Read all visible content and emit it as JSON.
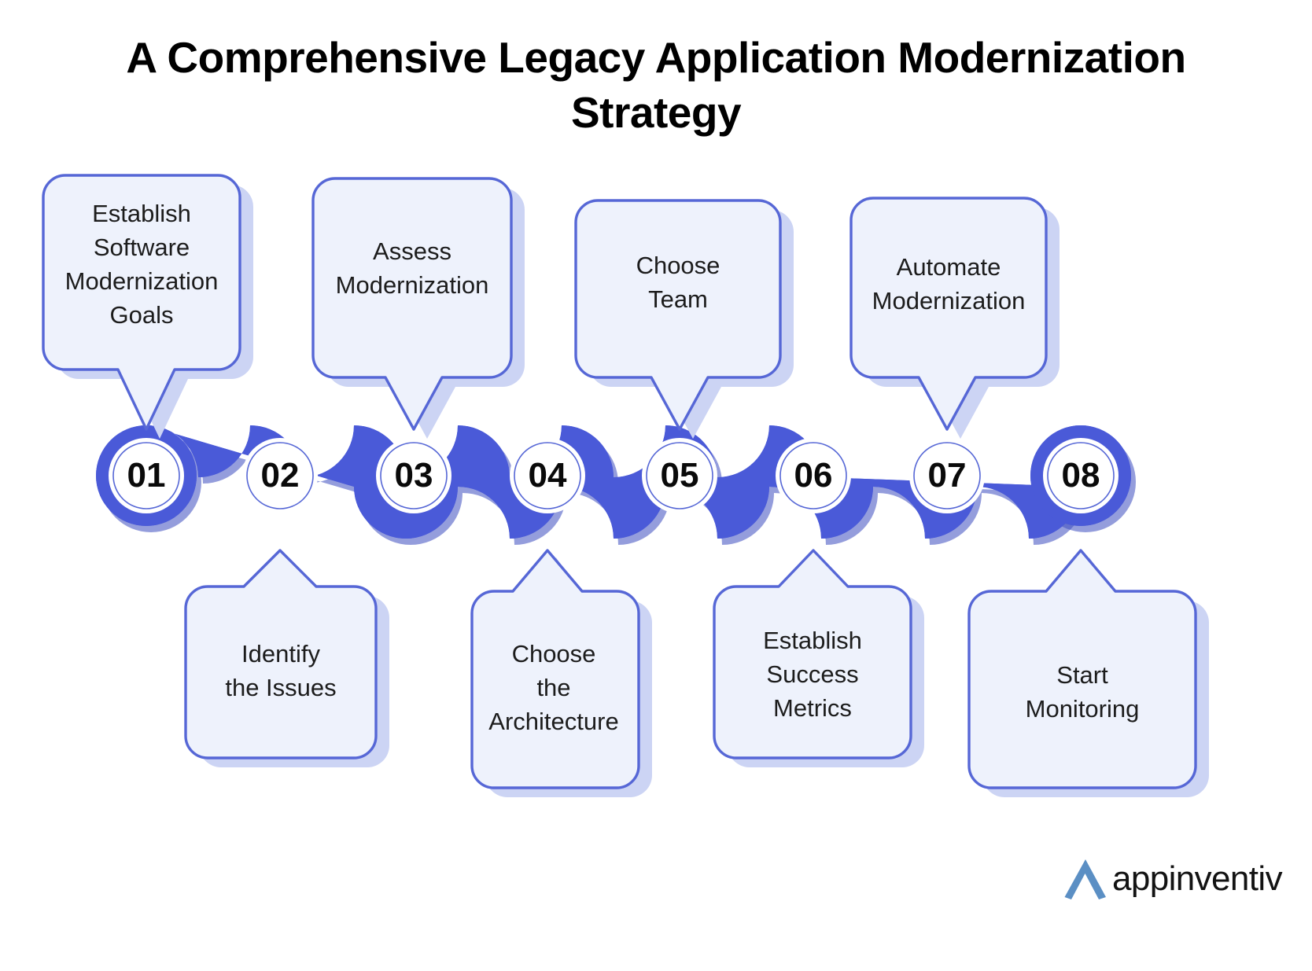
{
  "title": {
    "line1": "A Comprehensive Legacy Application Modernization",
    "line2": "Strategy"
  },
  "colors": {
    "band_blue": "#4a5ad8",
    "band_shadow": "#3d4cc0",
    "box_fill": "#eef2fc",
    "box_border": "#5667d6",
    "box_shadow": "#ccd4f4",
    "text": "#1c1c1c",
    "title": "#000000",
    "logo_mark": "#5b8fc4"
  },
  "steps": [
    {
      "number": "01",
      "label": "Establish Software Modernization Goals",
      "position": "top"
    },
    {
      "number": "02",
      "label": "Identify the Issues",
      "position": "bottom"
    },
    {
      "number": "03",
      "label": "Assess Modernization",
      "position": "top"
    },
    {
      "number": "04",
      "label": "Choose the Architecture",
      "position": "bottom"
    },
    {
      "number": "05",
      "label": "Choose Team",
      "position": "top"
    },
    {
      "number": "06",
      "label": "Establish Success Metrics",
      "position": "bottom"
    },
    {
      "number": "07",
      "label": "Automate Modernization",
      "position": "top"
    },
    {
      "number": "08",
      "label": "Start Monitoring",
      "position": "bottom"
    }
  ],
  "callouts_top": [
    {
      "step": "01",
      "lines": [
        "Establish",
        "Software",
        "Modernization",
        "Goals"
      ]
    },
    {
      "step": "03",
      "lines": [
        "Assess",
        "Modernization"
      ]
    },
    {
      "step": "05",
      "lines": [
        "Choose",
        "Team"
      ]
    },
    {
      "step": "07",
      "lines": [
        "Automate",
        "Modernization"
      ]
    }
  ],
  "callouts_bottom": [
    {
      "step": "02",
      "lines": [
        "Identify",
        "the Issues"
      ]
    },
    {
      "step": "04",
      "lines": [
        "Choose",
        "the",
        "Architecture"
      ]
    },
    {
      "step": "06",
      "lines": [
        "Establish",
        "Success",
        "Metrics"
      ]
    },
    {
      "step": "08",
      "lines": [
        "Start",
        "Monitoring"
      ]
    }
  ],
  "callout_text": {
    "c1": "Establish\nSoftware\nModernization\nGoals",
    "c3": "Assess\nModernization",
    "c5": "Choose\nTeam",
    "c7": "Automate\nModernization",
    "c2": "Identify\nthe Issues",
    "c4": "Choose\nthe\nArchitecture",
    "c6": "Establish\nSuccess\nMetrics",
    "c8": "Start\nMonitoring"
  },
  "numbers": {
    "n1": "01",
    "n2": "02",
    "n3": "03",
    "n4": "04",
    "n5": "05",
    "n6": "06",
    "n7": "07",
    "n8": "08"
  },
  "logo": {
    "word": "appinventiv",
    "mark": "a-chevron-icon"
  }
}
